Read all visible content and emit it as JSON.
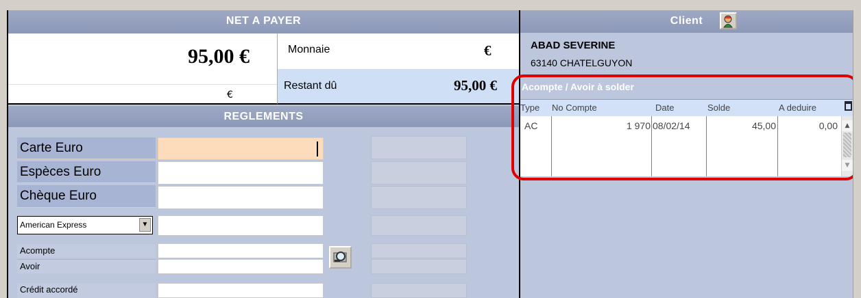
{
  "left": {
    "net_header": "NET A PAYER",
    "net_amount": "95,00 €",
    "currency_symbol": "€",
    "monnaie_label": "Monnaie",
    "monnaie_currency": "€",
    "restant_label": "Restant dû",
    "restant_value": "95,00 €",
    "reglements_header": "REGLEMENTS",
    "payments": {
      "carte": "Carte Euro",
      "especes": "Espèces Euro",
      "cheque": "Chèque Euro",
      "dropdown_selected": "American Express",
      "acompte": "Acompte",
      "avoir": "Avoir",
      "credit": "Crédit accordé"
    }
  },
  "right": {
    "client_header": "Client",
    "client_name": "ABAD SEVERINE",
    "client_city": "63140 CHATELGUYON",
    "acompte_title": "Acompte / Avoir à solder",
    "table": {
      "headers": [
        "Type",
        "No Compte",
        "Date",
        "Solde",
        "A deduire"
      ],
      "rows": [
        {
          "type": "AC",
          "no_compte": "1 970",
          "date": "08/02/14",
          "solde": "45,00",
          "a_deduire": "0,00"
        }
      ]
    }
  },
  "colors": {
    "header_blue": "#8c98b8",
    "highlight_red": "#e00000",
    "active_field": "#fddcbc"
  }
}
